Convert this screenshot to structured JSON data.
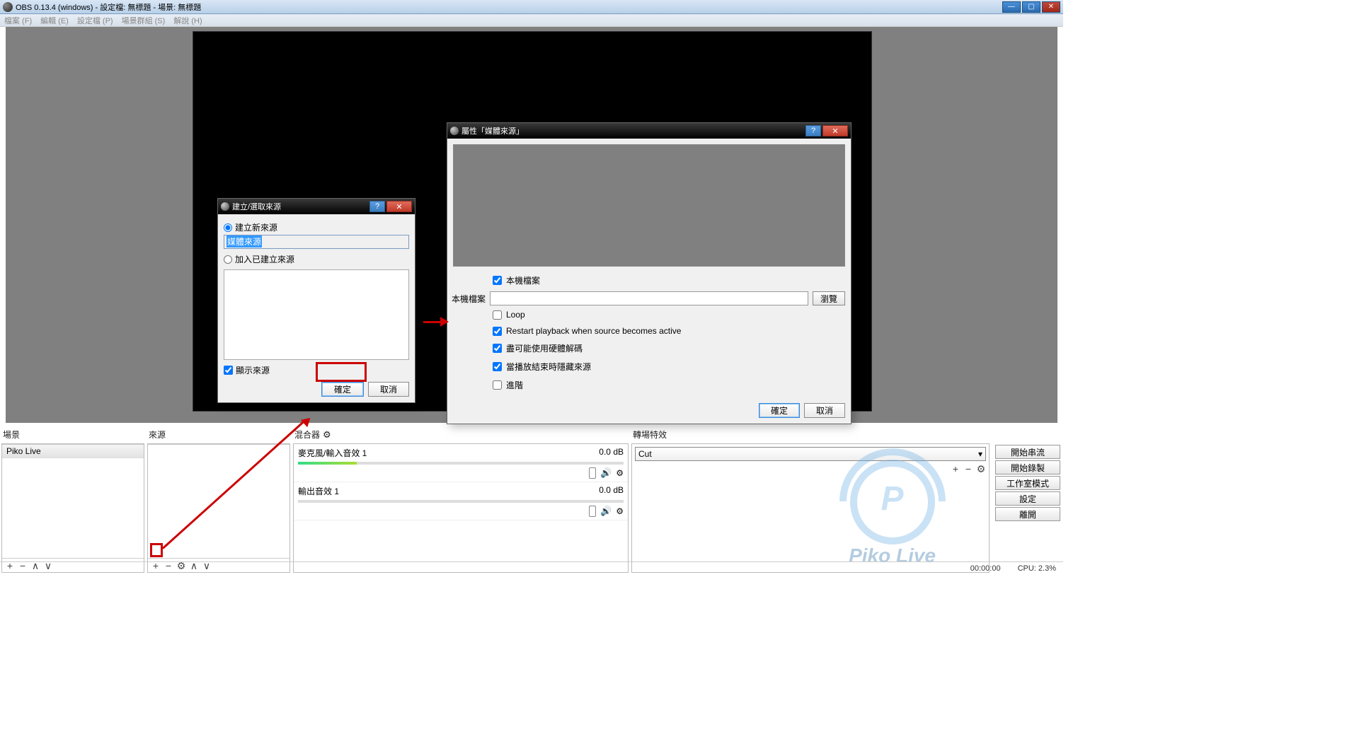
{
  "titlebar": {
    "title": "OBS 0.13.4 (windows) - 設定檔: 無標題 - 場景: 無標題"
  },
  "menu": {
    "file": "檔案 (F)",
    "edit": "編輯 (E)",
    "profile": "設定檔 (P)",
    "scenecol": "場景群組 (S)",
    "help": "解說 (H)"
  },
  "dialog1": {
    "title": "建立/選取來源",
    "create_new": "建立新來源",
    "input_value": "媒體來源",
    "add_existing": "加入已建立來源",
    "show_source": "顯示來源",
    "ok": "確定",
    "cancel": "取消"
  },
  "dialog2": {
    "title": "屬性「媒體來源」",
    "local_file_chk": "本機檔案",
    "local_file_lbl": "本機檔案",
    "browse": "瀏覽",
    "loop": "Loop",
    "restart": "Restart playback when source becomes active",
    "hwdecode": "盡可能使用硬體解碼",
    "hide_end": "當播放結束時隱藏來源",
    "advanced": "進階",
    "ok": "確定",
    "cancel": "取消"
  },
  "panels": {
    "scenes": "場景",
    "sources": "來源",
    "mixer": "混合器",
    "transitions": "轉場特效"
  },
  "scenes_list": {
    "item1": "Piko Live"
  },
  "mixer": {
    "r1_name": "麥克風/輸入音效 1",
    "r1_db": "0.0 dB",
    "r2_name": "輸出音效 1",
    "r2_db": "0.0 dB"
  },
  "transitions": {
    "selected": "Cut"
  },
  "right_buttons": {
    "b1": "開始串流",
    "b2": "開始錄製",
    "b3": "工作室模式",
    "b4": "設定",
    "b5": "離開"
  },
  "statusbar": {
    "time": "00:00:00",
    "cpu": "CPU: 2.3%"
  },
  "logo": {
    "text": "Piko Live"
  }
}
